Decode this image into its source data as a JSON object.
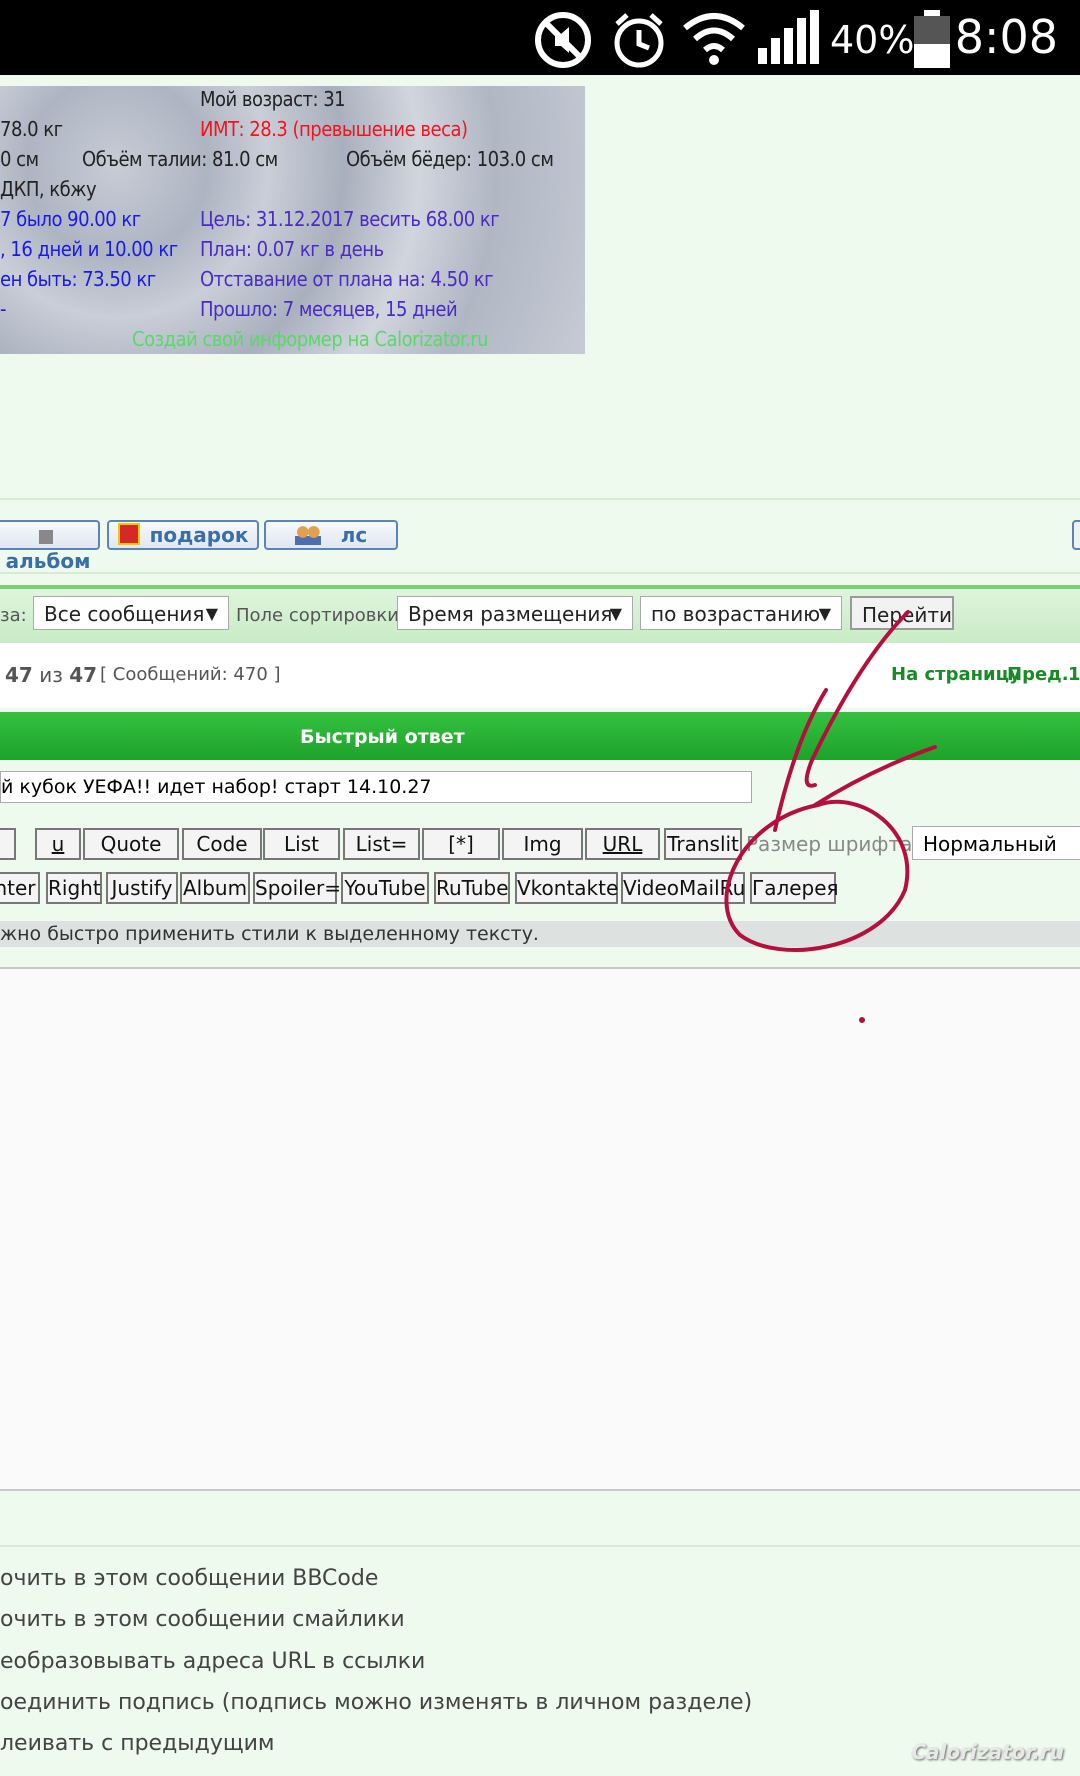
{
  "status_bar": {
    "battery_percent": "40%",
    "time": "8:08",
    "icons": [
      "mute-icon",
      "alarm-icon",
      "wifi-icon",
      "signal-icon",
      "battery-icon"
    ]
  },
  "informer": {
    "age": "Мой возраст: 31",
    "weight": "78.0 кг",
    "bmi": "ИМТ: 28.3 (превышение веса)",
    "height": "0 см",
    "waist": "Объём талии: 81.0 см",
    "hips": "Объём бёдер: 103.0 см",
    "bju": "ДКП, кбжу",
    "was": "7 было 90.00 кг",
    "goal": "Цель: 31.12.2017 весить 68.00 кг",
    "days": ", 16 дней и 10.00 кг",
    "plan": "План: 0.07 кг в день",
    "should": "ен быть: 73.50 кг",
    "lag": "Отставание от плана на: 4.50 кг",
    "dash": "-",
    "passed": "Прошло: 7 месяцев, 15 дней",
    "create": "Создай свой информер на Calorizator.ru"
  },
  "profile_buttons": {
    "album": "альбом",
    "gift": "подарок",
    "pm": "лс"
  },
  "sort_bar": {
    "for_label": "за:",
    "filter_value": "Все сообщения",
    "sort_field_label": "Поле сортировки",
    "sort_field_value": "Время размещения",
    "order_value": "по возрастанию",
    "go_button": "Перейти"
  },
  "pagination": {
    "page_current": "47",
    "of": "из",
    "page_total": "47",
    "messages": "[ Сообщений: 470 ]",
    "to_page": "На страницу",
    "prev": "Пред.",
    "first": "1"
  },
  "quick_reply": {
    "title": "Быстрый ответ",
    "subject": "й кубок УЕФА!! идет набор! старт 14.10.27",
    "font_size_label": "Размер шрифта:",
    "font_size_value": "Нормальный",
    "hint": "жно быстро применить стили к выделенному тексту."
  },
  "bbcode_row1": [
    "u",
    "Quote",
    "Code",
    "List",
    "List=",
    "[*]",
    "Img",
    "URL",
    "Translit"
  ],
  "bbcode_row2": [
    "nter",
    "Right",
    "Justify",
    "Album",
    "Spoiler=",
    "YouTube",
    "RuTube",
    "Vkontakte",
    "VideoMailRu",
    "Галерея"
  ],
  "options": [
    "очить в этом сообщении BBCode",
    "очить в этом сообщении смайлики",
    "еобразовывать адреса URL в ссылки",
    "оединить подпись (подпись можно изменять в личном разделе)",
    "леивать с предыдущим"
  ],
  "watermark": "Calorizator.ru",
  "colors": {
    "green_header": "#1ea22b",
    "page_bg": "#eefaed",
    "annotation": "#b5103d"
  }
}
